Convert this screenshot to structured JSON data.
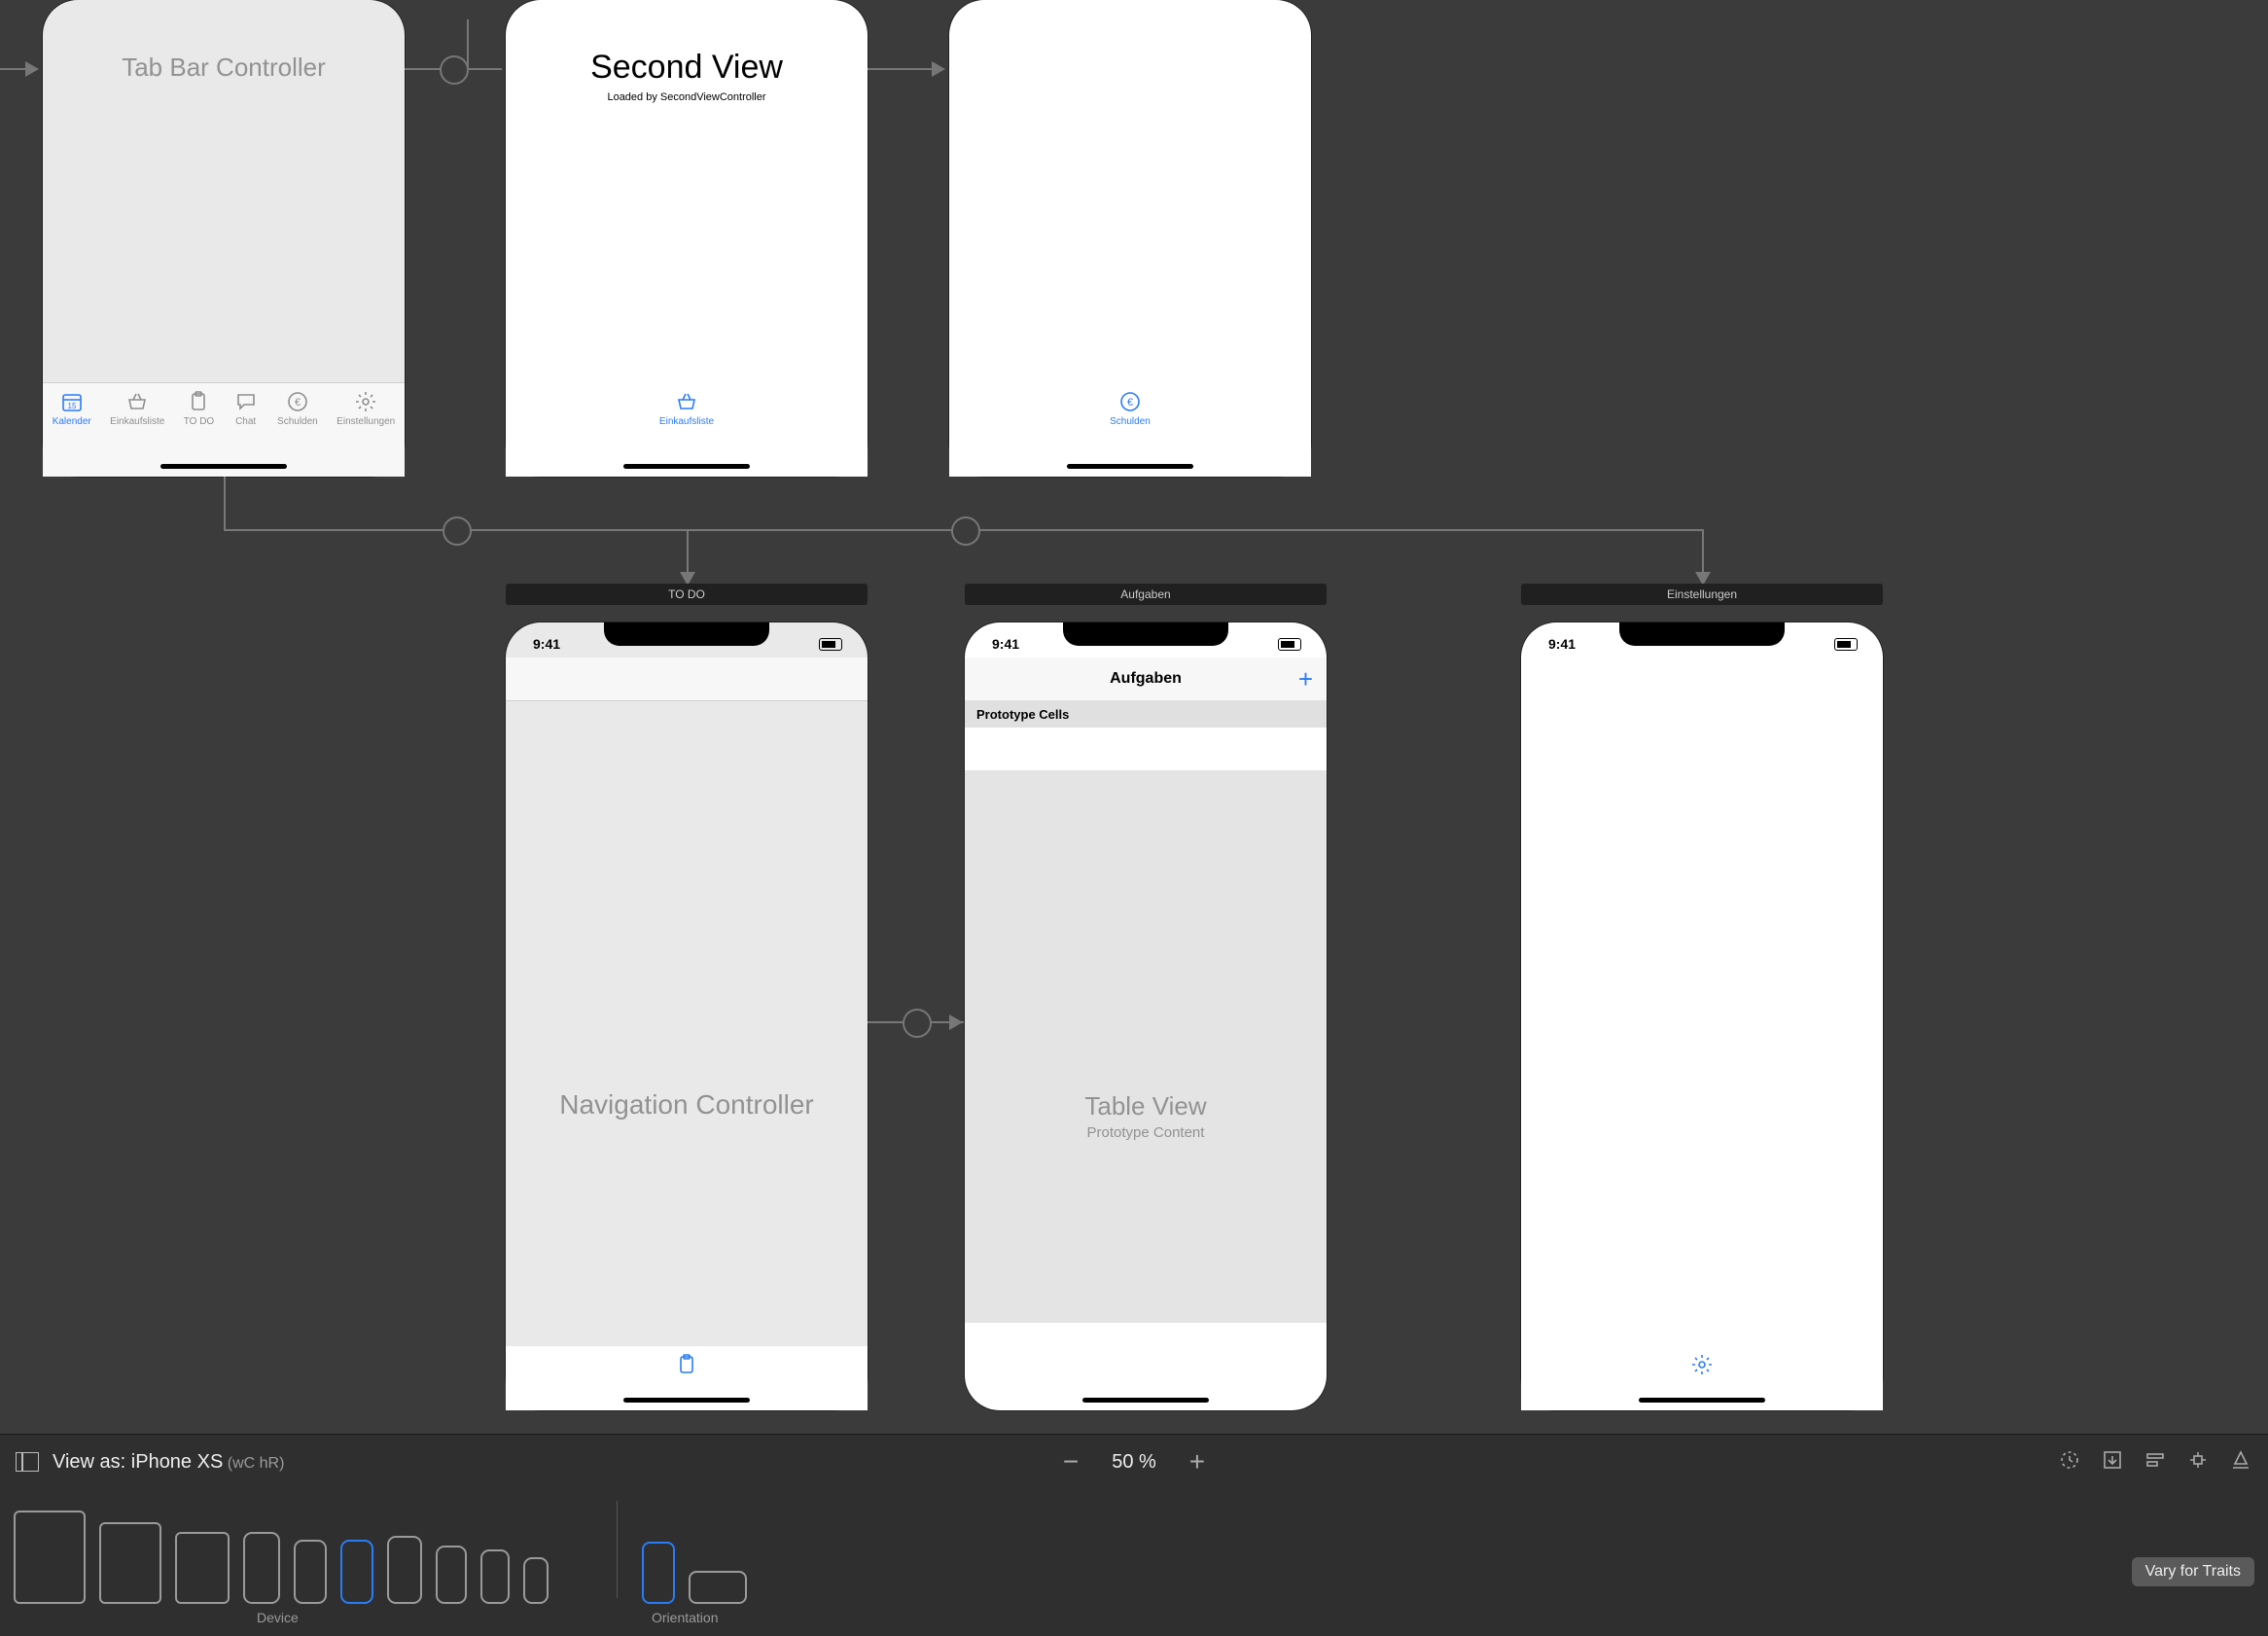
{
  "scenes": {
    "tabbar_controller": {
      "title": "Tab Bar Controller"
    },
    "second_view": {
      "title": "Second View",
      "subtitle": "Loaded by SecondViewController"
    },
    "todo": {
      "bar": "TO DO",
      "body": "Navigation Controller"
    },
    "aufgaben": {
      "bar": "Aufgaben",
      "nav_title": "Aufgaben",
      "proto_header": "Prototype Cells",
      "tv_title": "Table View",
      "tv_sub": "Prototype Content",
      "plus": "+"
    },
    "einstellungen": {
      "bar": "Einstellungen"
    }
  },
  "status": {
    "time": "9:41"
  },
  "tabs": {
    "kalender": "Kalender",
    "einkaufsliste": "Einkaufsliste",
    "todo": "TO DO",
    "chat": "Chat",
    "schulden": "Schulden",
    "einstellungen": "Einstellungen"
  },
  "bottom": {
    "view_as_prefix": "View as: ",
    "device_name": "iPhone XS",
    "size_class": " (wC hR)",
    "zoom": "50 %",
    "device_label": "Device",
    "orientation_label": "Orientation",
    "vary": "Vary for Traits"
  }
}
